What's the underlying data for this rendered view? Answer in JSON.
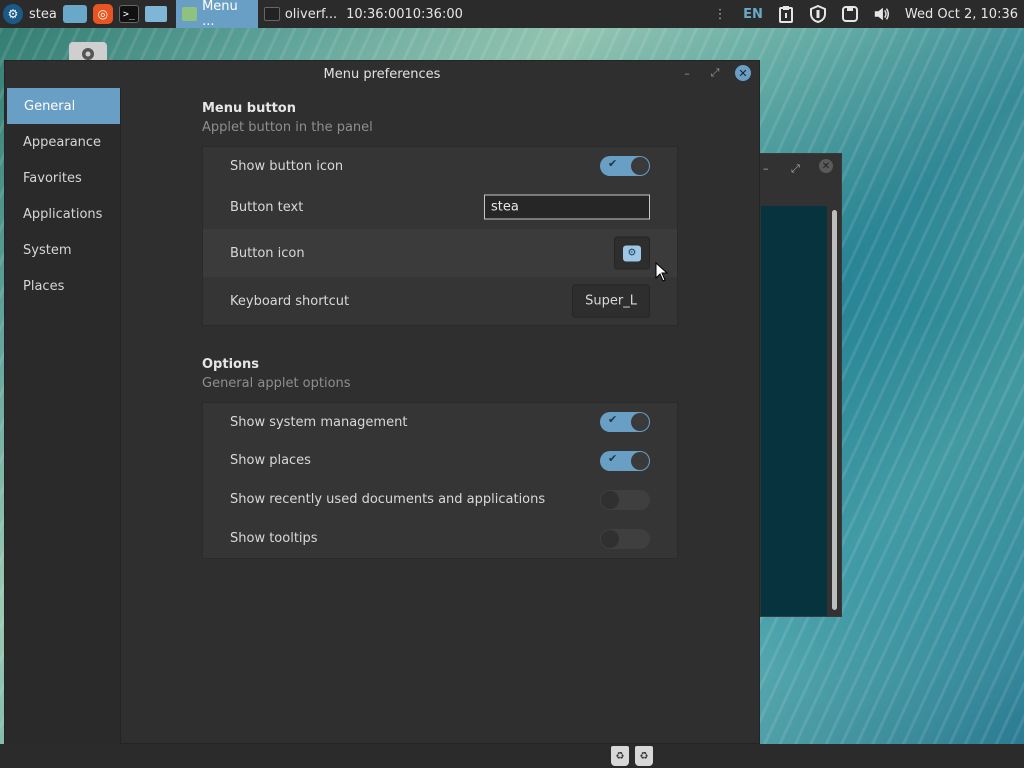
{
  "top_panel": {
    "app_label": "stea",
    "tasks": [
      {
        "label": "Menu ...",
        "active": true
      },
      {
        "label": "oliverf...",
        "active": false
      }
    ],
    "clock_text": "10:36:0010:36:00",
    "keyboard_layout": "EN",
    "datetime": "Wed Oct 2, 10:36"
  },
  "dialog": {
    "title": "Menu preferences",
    "sidebar": {
      "items": [
        {
          "label": "General",
          "active": true
        },
        {
          "label": "Appearance",
          "active": false
        },
        {
          "label": "Favorites",
          "active": false
        },
        {
          "label": "Applications",
          "active": false
        },
        {
          "label": "System",
          "active": false
        },
        {
          "label": "Places",
          "active": false
        }
      ]
    },
    "menu_button": {
      "title": "Menu button",
      "subtitle": "Applet button in the panel",
      "show_button_icon": {
        "label": "Show button icon",
        "on": true
      },
      "button_text": {
        "label": "Button text",
        "value": "stea"
      },
      "button_icon": {
        "label": "Button icon"
      },
      "keyboard_shortcut": {
        "label": "Keyboard shortcut",
        "value": "Super_L"
      }
    },
    "options": {
      "title": "Options",
      "subtitle": "General applet options",
      "rows": [
        {
          "label": "Show system management",
          "on": true
        },
        {
          "label": "Show places",
          "on": true
        },
        {
          "label": "Show recently used documents and applications",
          "on": false
        },
        {
          "label": "Show tooltips",
          "on": false
        }
      ]
    }
  },
  "colors": {
    "accent": "#6a9fc5",
    "panel_bg": "#2b2b2b",
    "dialog_bg": "#2f2f2f"
  }
}
